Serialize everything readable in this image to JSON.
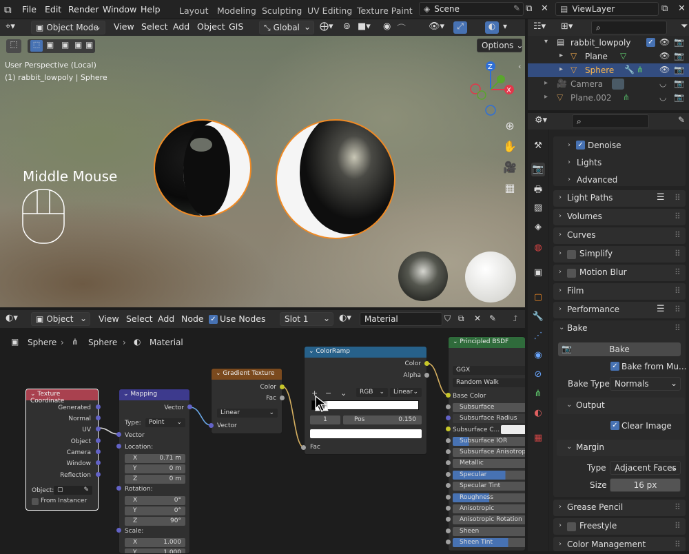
{
  "menubar": {
    "items": [
      "File",
      "Edit",
      "Render",
      "Window",
      "Help"
    ]
  },
  "workspaces": [
    "Layout",
    "Modeling",
    "Sculpting",
    "UV Editing",
    "Texture Paint"
  ],
  "scene": {
    "label": "Scene"
  },
  "viewlayer": {
    "label": "ViewLayer"
  },
  "viewport_header": {
    "mode": "Object Mode",
    "menus": [
      "View",
      "Select",
      "Add",
      "Object",
      "GIS"
    ],
    "transform": "Global",
    "options_label": "Options"
  },
  "viewport": {
    "perspective": "User Perspective (Local)",
    "object_info": "(1) rabbit_lowpoly | Sphere",
    "middle_mouse": "Middle Mouse"
  },
  "outliner": {
    "items": [
      {
        "name": "rabbit_lowpoly",
        "level": 0
      },
      {
        "name": "Plane",
        "level": 1
      },
      {
        "name": "Sphere",
        "level": 1,
        "selected": true
      },
      {
        "name": "Camera",
        "level": 0,
        "dim": true
      },
      {
        "name": "Plane.002",
        "level": 0,
        "dim": true
      }
    ]
  },
  "properties": {
    "sections": [
      {
        "label": "Denoise",
        "sub": true,
        "checkbox": true,
        "checked": true
      },
      {
        "label": "Lights",
        "sub": true
      },
      {
        "label": "Advanced",
        "sub": true
      },
      {
        "label": "Light Paths"
      },
      {
        "label": "Volumes"
      },
      {
        "label": "Curves"
      },
      {
        "label": "Simplify",
        "checkbox": true
      },
      {
        "label": "Motion Blur",
        "checkbox": true
      },
      {
        "label": "Film"
      },
      {
        "label": "Performance"
      },
      {
        "label": "Bake",
        "open": true
      }
    ],
    "bake": {
      "button": "Bake",
      "bake_from_multires": "Bake from Mu...",
      "bake_type_label": "Bake Type",
      "bake_type": "Normals",
      "output": "Output",
      "clear_image": "Clear Image",
      "margin": "Margin",
      "type_label": "Type",
      "type_value": "Adjacent Faces",
      "size_label": "Size",
      "size_value": "16 px"
    },
    "after": [
      {
        "label": "Grease Pencil"
      },
      {
        "label": "Freestyle",
        "checkbox": true
      },
      {
        "label": "Color Management"
      }
    ]
  },
  "node_header": {
    "editor": "Object",
    "menus": [
      "View",
      "Select",
      "Add",
      "Node"
    ],
    "use_nodes": "Use Nodes",
    "slot": "Slot 1",
    "material": "Material"
  },
  "breadcrumb": [
    "Sphere",
    "Sphere",
    "Material"
  ],
  "nodes": {
    "texcoord": {
      "title": "Texture Coordinate",
      "outputs": [
        "Generated",
        "Normal",
        "UV",
        "Object",
        "Camera",
        "Window",
        "Reflection"
      ],
      "object_label": "Object:",
      "from_instancer": "From Instancer"
    },
    "mapping": {
      "title": "Mapping",
      "output": "Vector",
      "type_label": "Type:",
      "type_value": "Point",
      "input": "Vector",
      "location": "Location:",
      "loc": [
        [
          "X",
          "0.71 m"
        ],
        [
          "Y",
          "0 m"
        ],
        [
          "Z",
          "0 m"
        ]
      ],
      "rotation": "Rotation:",
      "rot": [
        [
          "X",
          "0°"
        ],
        [
          "Y",
          "0°"
        ],
        [
          "Z",
          "90°"
        ]
      ],
      "scale": "Scale:",
      "scl": [
        [
          "X",
          "1.000"
        ],
        [
          "Y",
          "1.000"
        ]
      ]
    },
    "gradient": {
      "title": "Gradient Texture",
      "outputs": [
        "Color",
        "Fac"
      ],
      "type_value": "Linear",
      "input": "Vector"
    },
    "colorramp": {
      "title": "ColorRamp",
      "outputs": [
        "Color",
        "Alpha"
      ],
      "mode": "RGB",
      "interp": "Linear",
      "index": "1",
      "pos_label": "Pos",
      "pos_value": "0.150",
      "input": "Fac",
      "controls": [
        "+",
        "−",
        "⌄"
      ]
    },
    "principled": {
      "title": "Principled BSDF",
      "distribution": "GGX",
      "sss_method": "Random Walk",
      "inputs": [
        "Base Color",
        "Subsurface",
        "Subsurface Radius",
        "Subsurface C...",
        "Subsurface IOR",
        "Subsurface Anisotropy",
        "Metallic",
        "Specular",
        "Specular Tint",
        "Roughness",
        "Anisotropic",
        "Anisotropic Rotation",
        "Sheen",
        "Sheen Tint"
      ]
    }
  },
  "colors": {
    "accent": "#4772b3",
    "selection": "#f08a24"
  }
}
